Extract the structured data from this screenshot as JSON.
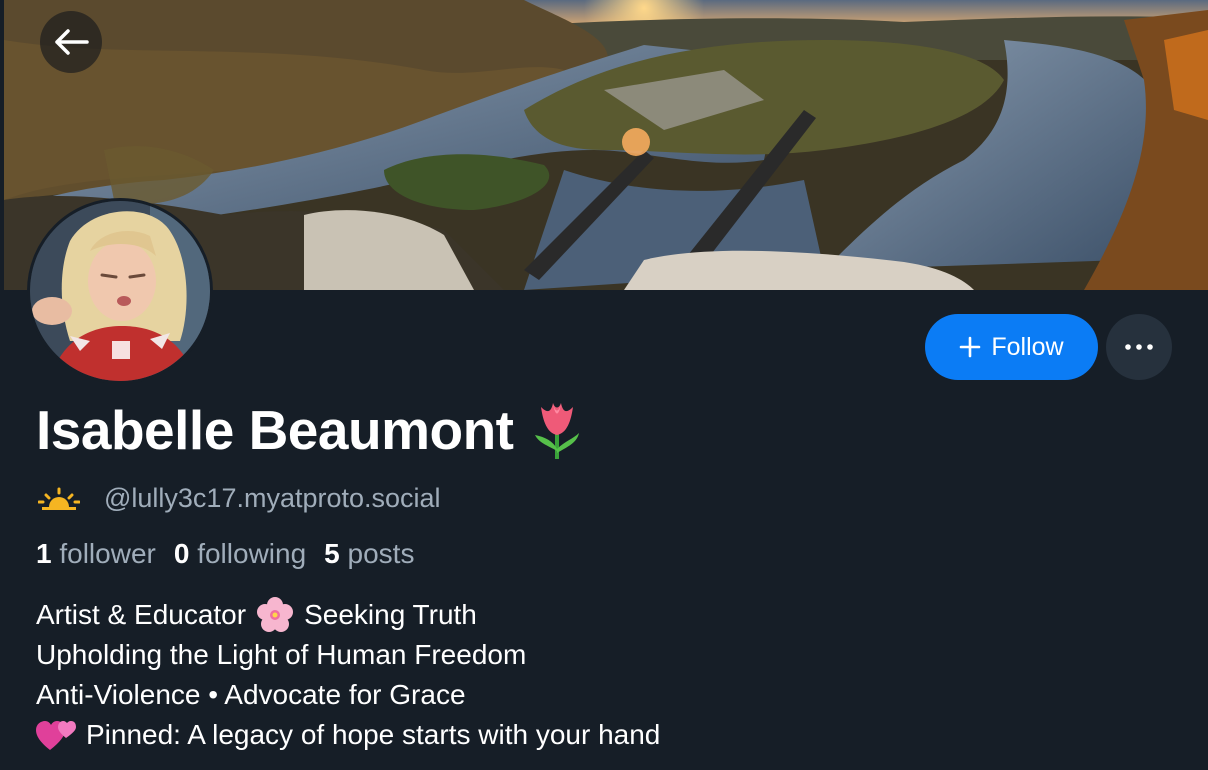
{
  "profile": {
    "display_name": "Isabelle Beaumont",
    "name_emoji_icon": "tulip-icon",
    "handle": "@lully3c17.myatproto.social",
    "handle_icon": "sunrise-icon",
    "followers_count": "1",
    "followers_label": "follower",
    "following_count": "0",
    "following_label": "following",
    "posts_count": "5",
    "posts_label": "posts"
  },
  "actions": {
    "follow_label": "Follow",
    "follow_icon": "plus-icon",
    "more_icon": "ellipsis-icon",
    "back_icon": "arrow-left-icon"
  },
  "bio": {
    "line1_before": "Artist & Educator",
    "line1_icon": "cherry-blossom-icon",
    "line1_after": "Seeking Truth",
    "line2": "Upholding the Light of Human Freedom",
    "line3": "Anti-Violence • Advocate for Grace",
    "line4_icon": "two-hearts-icon",
    "line4": "Pinned: A legacy of hope starts with your hand"
  },
  "colors": {
    "background": "#161e27",
    "accent": "#0b7cf5",
    "secondary_text": "#a0adba",
    "primary_text": "#ffffff"
  }
}
